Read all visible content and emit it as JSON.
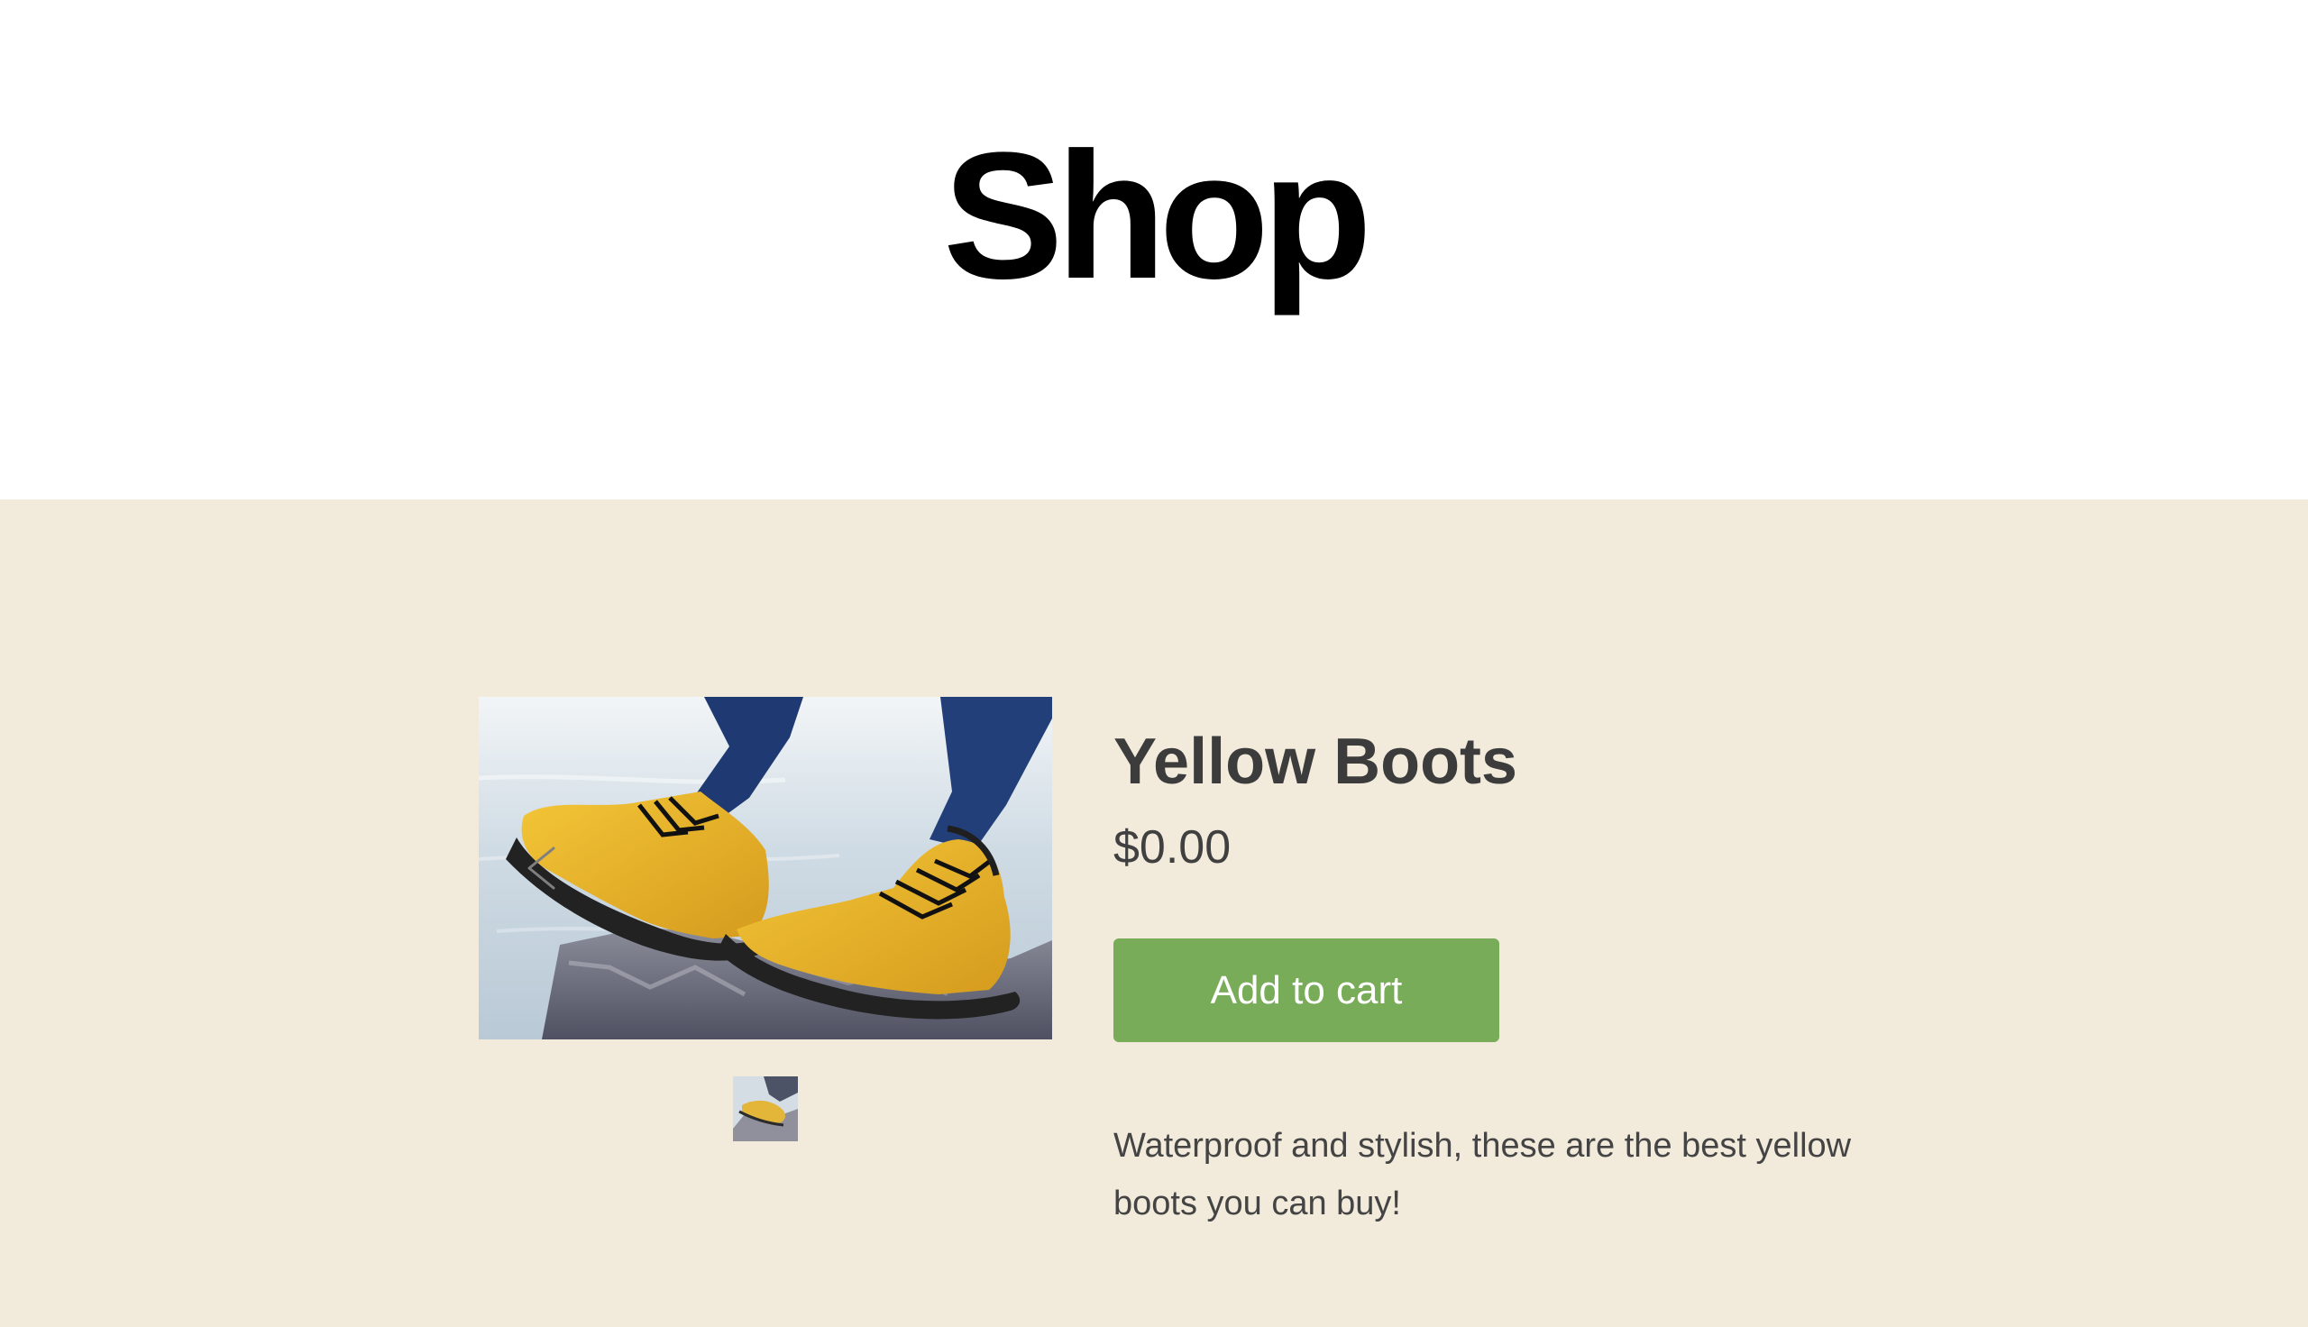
{
  "header": {
    "title": "Shop"
  },
  "product": {
    "name": "Yellow Boots",
    "price": "$0.00",
    "add_to_cart_label": "Add to cart",
    "description": "Waterproof and stylish, these are the best yellow boots you can buy!",
    "image_alt": "Yellow boots"
  },
  "colors": {
    "header_background": "#ffffff",
    "section_background": "#f2eadb",
    "button_background": "#78ac58",
    "button_text": "#ffffff",
    "text": "#3f3f3f"
  },
  "icons": {
    "gallery_previous": "chevron-left-icon"
  }
}
